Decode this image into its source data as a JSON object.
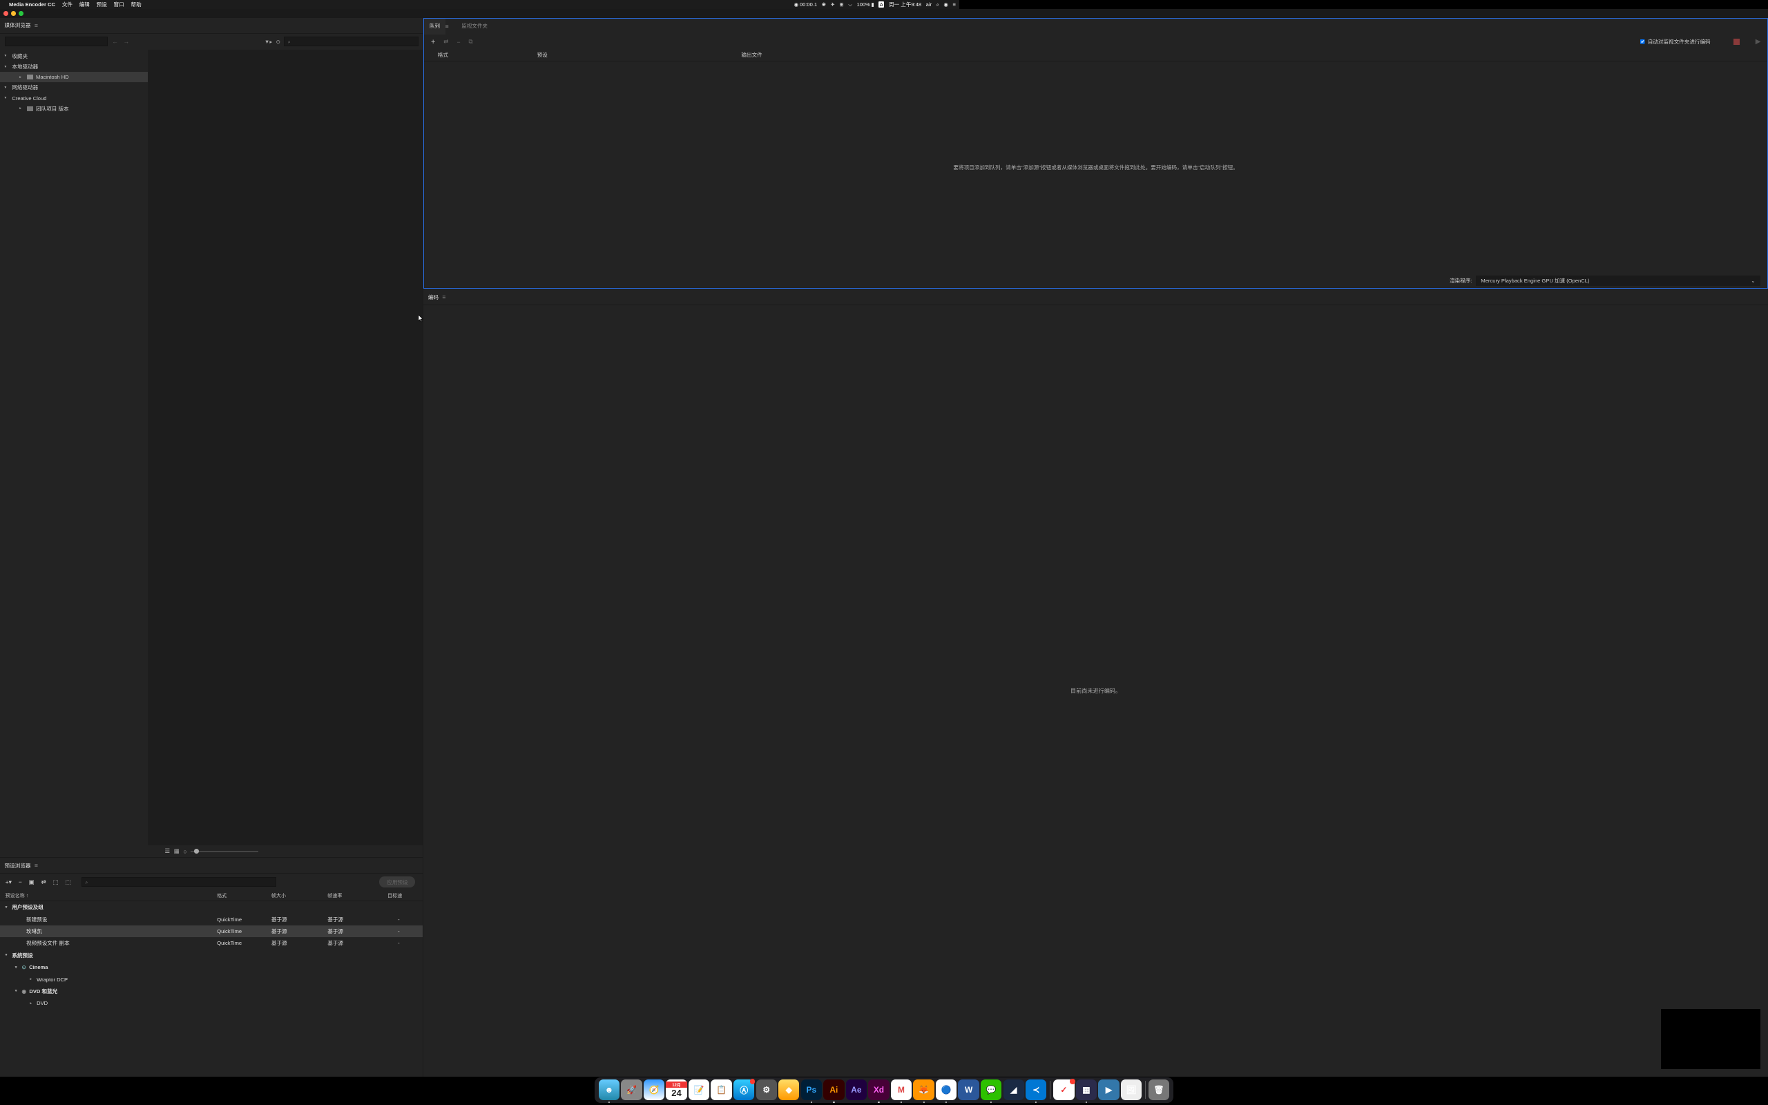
{
  "menubar": {
    "app_name": "Media Encoder CC",
    "items": [
      "文件",
      "编辑",
      "预设",
      "窗口",
      "帮助"
    ],
    "status": {
      "rec_time": "00:00.1",
      "battery": "100%",
      "date": "周一 上午9:48",
      "user": "air",
      "input": "A"
    }
  },
  "media_browser": {
    "title": "媒体浏览器",
    "search_placeholder": "⌕",
    "tree": {
      "favorites": "收藏夹",
      "local_drives": "本地驱动器",
      "macintosh_hd": "Macintosh HD",
      "network_drives": "网络驱动器",
      "creative_cloud": "Creative Cloud",
      "team_projects": "团队项目 版本"
    }
  },
  "preset_browser": {
    "title": "预设浏览器",
    "apply_label": "应用预设",
    "headers": {
      "name": "预设名称 ↑",
      "format": "格式",
      "frame_size": "帧大小",
      "frame_rate": "帧速率",
      "target": "目标速"
    },
    "groups": {
      "user": "用户预设及组",
      "system": "系统预设",
      "cinema": "Cinema",
      "wraptor": "Wraptor DCP",
      "dvd_bluray": "DVD 和蓝光",
      "dvd": "DVD"
    },
    "rows": [
      {
        "name": "新建预设",
        "format": "QuickTime",
        "frame_size": "基于源",
        "frame_rate": "基于源",
        "target": "-"
      },
      {
        "name": "玫琳凯",
        "format": "QuickTime",
        "frame_size": "基于源",
        "frame_rate": "基于源",
        "target": "-",
        "selected": true
      },
      {
        "name": "视频预设文件 副本",
        "format": "QuickTime",
        "frame_size": "基于源",
        "frame_rate": "基于源",
        "target": "-"
      }
    ]
  },
  "queue": {
    "tab_queue": "队列",
    "tab_watch": "监视文件夹",
    "auto_encode_label": "自动对监视文件夹进行编码",
    "headers": {
      "format": "格式",
      "preset": "预设",
      "output": "输出文件"
    },
    "empty_message": "要将项目添加到队列，请单击\"添加源\"按钮或者从媒体浏览器或桌面将文件拖到此处。要开始编码，请单击\"启动队列\"按钮。",
    "renderer_label": "渲染程序:",
    "renderer_value": "Mercury Playback Engine GPU 加速 (OpenCL)"
  },
  "encoding": {
    "title": "编码",
    "empty_message": "目前尚未进行编码。"
  },
  "dock_apps": [
    "Finder",
    "Launchpad",
    "Safari",
    "Calendar",
    "Notes",
    "Reminders",
    "AppStore",
    "Settings",
    "Sketch",
    "Ps",
    "Ai",
    "Ae",
    "Xd",
    "Gmail",
    "Firefox",
    "Chrome",
    "Word",
    "WeChat",
    "?",
    "VSCode",
    "|",
    "Todoist",
    "?",
    "QQPlayer",
    "Preview",
    "|",
    "Trash"
  ]
}
